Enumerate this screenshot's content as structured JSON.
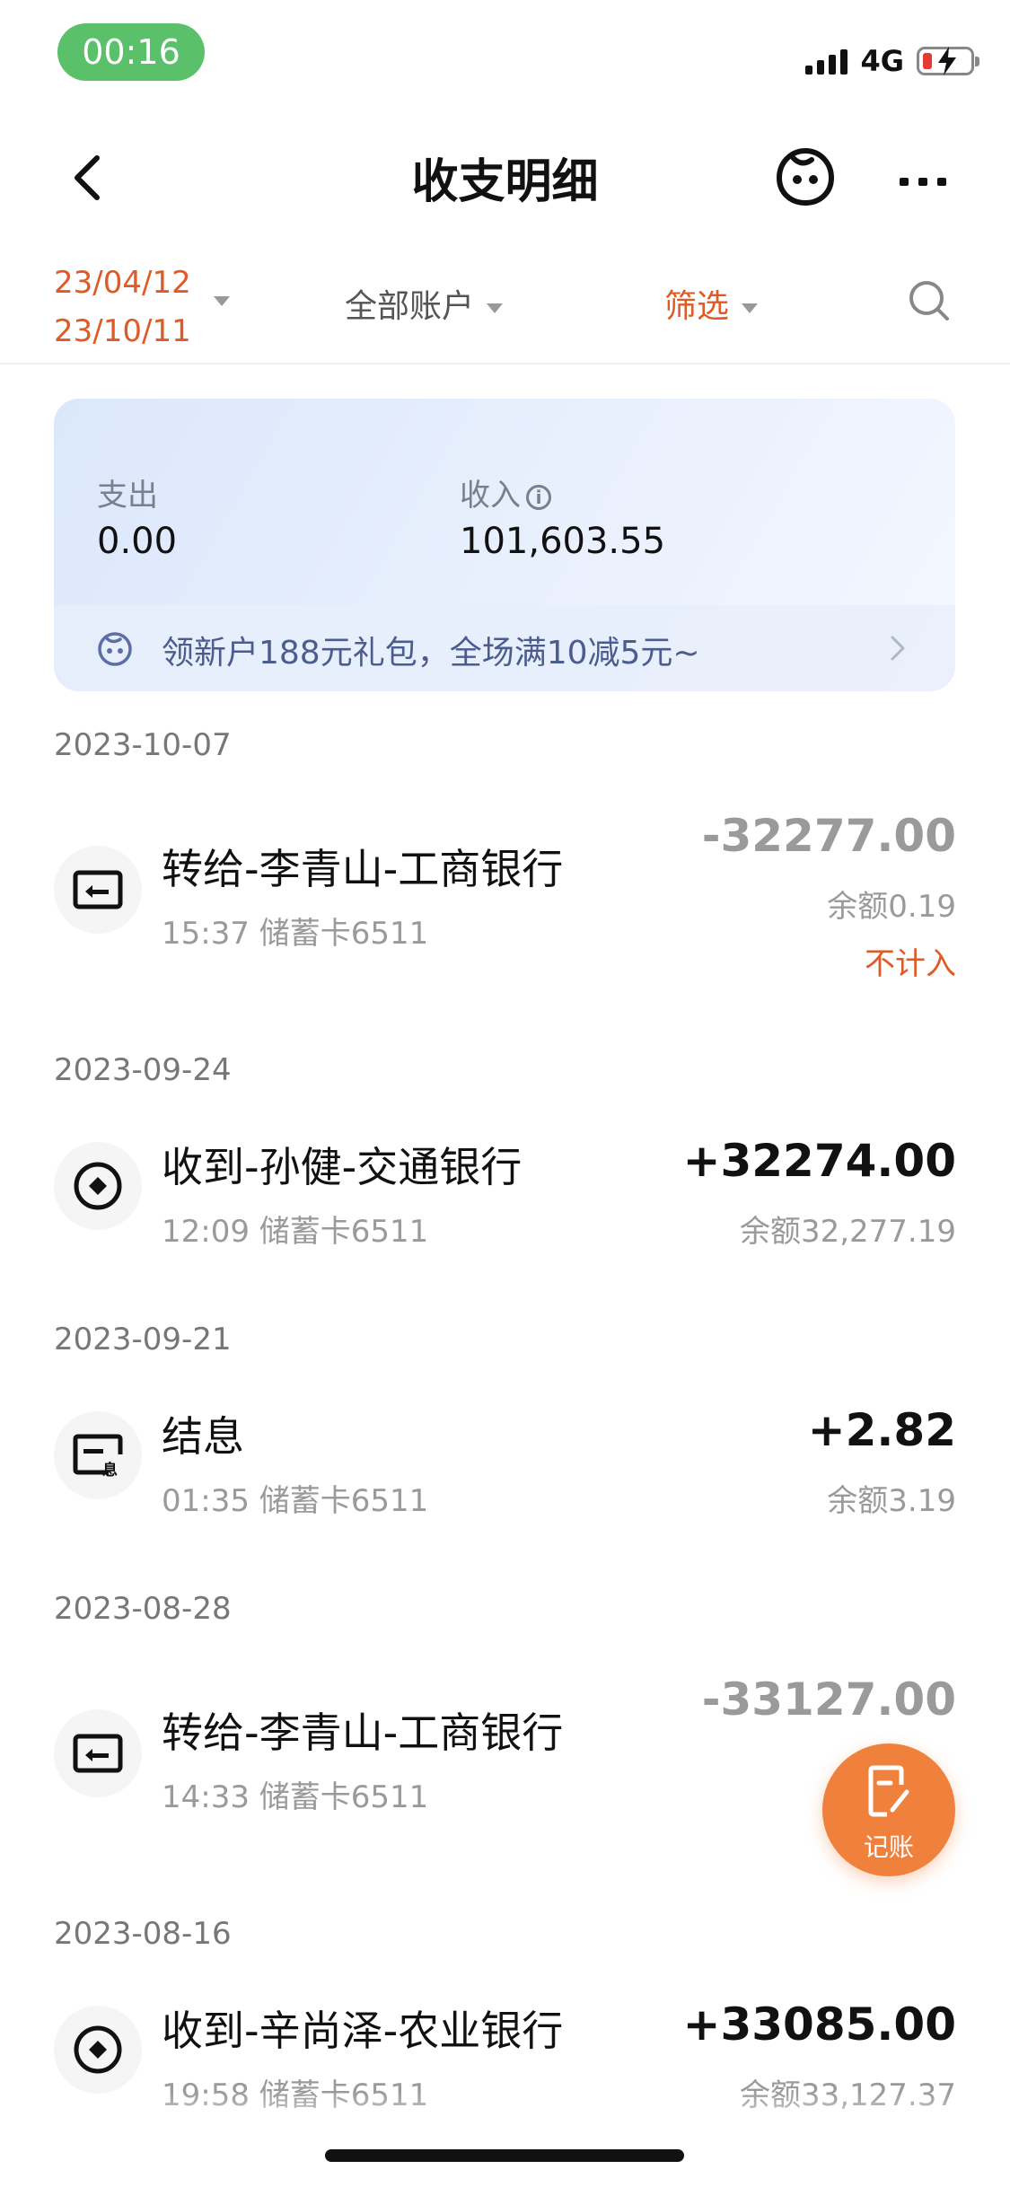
{
  "status_bar": {
    "time": "00:16",
    "network": "4G"
  },
  "nav": {
    "title": "收支明细"
  },
  "filters": {
    "date_start": "23/04/12",
    "date_end": "23/10/11",
    "accounts": "全部账户",
    "filter": "筛选"
  },
  "summary": {
    "expense_label": "支出",
    "expense_value": "0.00",
    "income_label": "收入",
    "income_value": "101,603.55",
    "promo_text": "领新户188元礼包，全场满10减5元~"
  },
  "transactions": [
    {
      "date": "2023-10-07",
      "title": "转给-李青山-工商银行",
      "subtitle": "15:37 储蓄卡6511",
      "amount": "-32277.00",
      "balance": "余额0.19",
      "tag": "不计入",
      "icon": "transfer-out-icon"
    },
    {
      "date": "2023-09-24",
      "title": "收到-孙健-交通银行",
      "subtitle": "12:09 储蓄卡6511",
      "amount": "+32274.00",
      "balance": "余额32,277.19",
      "icon": "receive-icon"
    },
    {
      "date": "2023-09-21",
      "title": "结息",
      "subtitle": "01:35 储蓄卡6511",
      "amount": "+2.82",
      "balance": "余额3.19",
      "icon": "interest-icon"
    },
    {
      "date": "2023-08-28",
      "title": "转给-李青山-工商银行",
      "subtitle": "14:33 储蓄卡6511",
      "amount": "-33127.00",
      "icon": "transfer-out-icon"
    },
    {
      "date": "2023-08-16",
      "title": "收到-辛尚泽-农业银行",
      "subtitle": "19:58 储蓄卡6511",
      "amount": "+33085.00",
      "balance": "余额33,127.37",
      "icon": "receive-icon"
    }
  ],
  "fab": {
    "label": "记账"
  },
  "colors": {
    "accent": "#e05a27",
    "fab": "#f0813d",
    "status_pill": "#5bc06a"
  }
}
